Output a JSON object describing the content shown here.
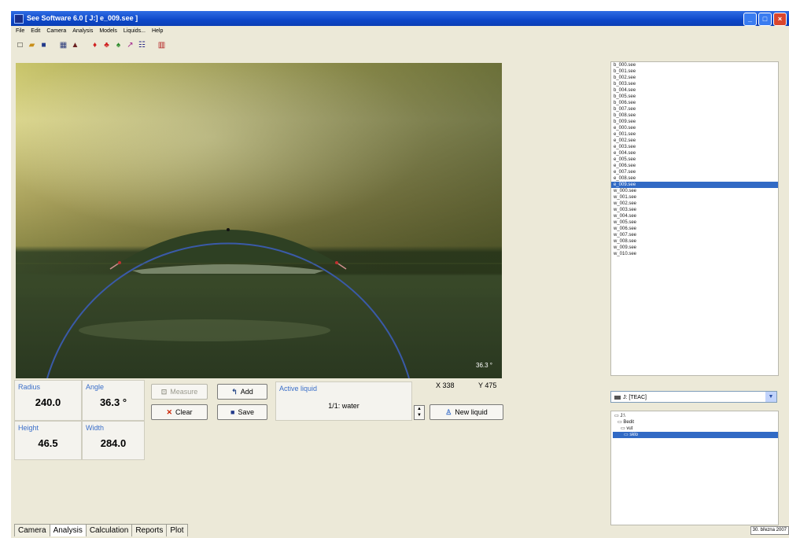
{
  "window": {
    "title": "See Software 6.0  [ J:] e_009.see ]"
  },
  "titlebar_buttons": {
    "minimize": "_",
    "maximize": "□",
    "close": "×"
  },
  "menu": [
    "File",
    "Edit",
    "Camera",
    "Analysis",
    "Models",
    "Liquids...",
    "Help"
  ],
  "toolbar_icons": [
    "new-icon",
    "open-icon",
    "save-icon",
    "grid-icon",
    "drop-icon",
    "red-drop-icon",
    "multi-drop-icon",
    "color-drops-icon",
    "chart-icon",
    "settings-icon",
    "report-icon"
  ],
  "image": {
    "angle_overlay": "36.3 °"
  },
  "measurements": {
    "radius_label": "Radius",
    "radius_value": "240.0",
    "angle_label": "Angle",
    "angle_value": "36.3 °",
    "height_label": "Height",
    "height_value": "46.5",
    "width_label": "Width",
    "width_value": "284.0"
  },
  "buttons": {
    "measure": "Measure",
    "add": "Add",
    "clear": "Clear",
    "save": "Save",
    "new_liquid": "New liquid"
  },
  "liquid": {
    "label": "Active liquid",
    "value": "1/1: water"
  },
  "coords": {
    "x": "X 338",
    "y": "Y 475"
  },
  "files": [
    "b_000.see",
    "b_001.see",
    "b_002.see",
    "b_003.see",
    "b_004.see",
    "b_005.see",
    "b_006.see",
    "b_007.see",
    "b_008.see",
    "b_009.see",
    "e_000.see",
    "e_001.see",
    "e_002.see",
    "e_003.see",
    "e_004.see",
    "e_005.see",
    "e_006.see",
    "e_007.see",
    "e_008.see",
    "e_009.see",
    "w_000.see",
    "w_001.see",
    "w_002.see",
    "w_003.see",
    "w_004.see",
    "w_005.see",
    "w_006.see",
    "w_007.see",
    "w_008.see",
    "w_009.see",
    "w_010.see"
  ],
  "selected_file": "e_009.see",
  "drive": {
    "label": "J: [TEAC]"
  },
  "dirs": [
    "J:\\",
    "Bedit",
    "vut",
    "sklo"
  ],
  "selected_dir": "sklo",
  "tabs": [
    "Camera",
    "Analysis",
    "Calculation",
    "Reports",
    "Plot"
  ],
  "active_tab": "Analysis",
  "status": {
    "date": "30. března 2007"
  },
  "colors": {
    "accent": "#316ac5",
    "label_blue": "#3b6fc9",
    "clear_red": "#cc2200"
  }
}
